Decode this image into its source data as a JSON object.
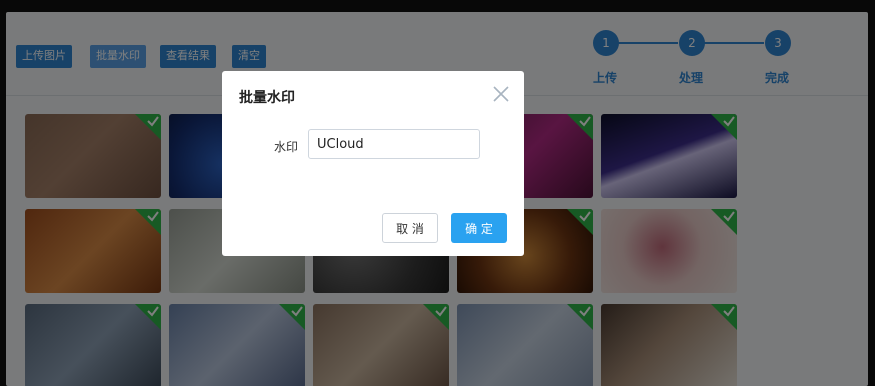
{
  "toolbar": {
    "upload_label": "上传图片",
    "batch_watermark_label": "批量水印",
    "view_results_label": "查看结果",
    "clear_label": "清空"
  },
  "steps": [
    {
      "number": "1",
      "label": "上传"
    },
    {
      "number": "2",
      "label": "处理"
    },
    {
      "number": "3",
      "label": "完成"
    }
  ],
  "gallery": {
    "row1": [
      "stars-on-wood",
      "blue-tree-night",
      "",
      "magenta-abstract",
      "light-streaks"
    ],
    "row2": [
      "seashell",
      "misty-gray",
      "pebbles",
      "jewelry",
      "dried-flower"
    ],
    "row3": [
      "metal-cubes",
      "blossom-branch",
      "headphones",
      "misty-blue",
      "dining-room"
    ],
    "selected": true
  },
  "modal": {
    "title": "批量水印",
    "watermark_label": "水印",
    "watermark_value": "UCloud",
    "cancel_label": "取 消",
    "confirm_label": "确 定"
  },
  "colors": {
    "primary": "#2e84d1",
    "confirm": "#2aa2f0",
    "check": "#2fb548"
  }
}
